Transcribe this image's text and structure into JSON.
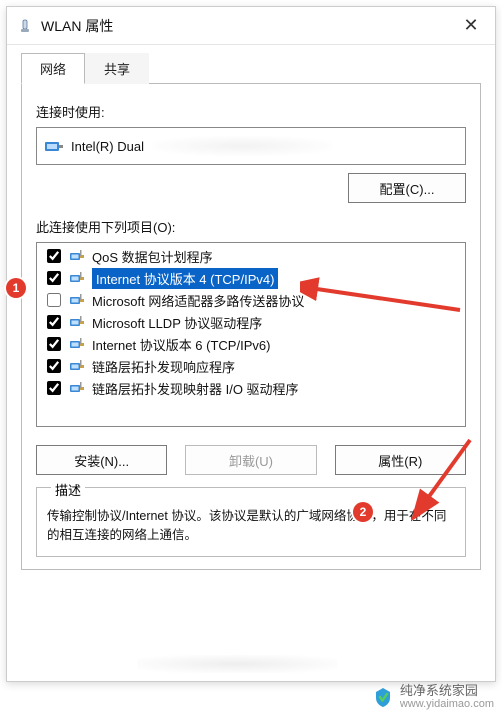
{
  "window": {
    "title": "WLAN 属性",
    "close_glyph": "✕"
  },
  "tabs": {
    "network": "网络",
    "sharing": "共享"
  },
  "labels": {
    "connect_using": "连接时使用:",
    "adapter": "Intel(R) Dual",
    "configure": "配置(C)...",
    "items_label": "此连接使用下列项目(O):",
    "install": "安装(N)...",
    "uninstall": "卸载(U)",
    "properties": "属性(R)",
    "desc_heading": "描述",
    "desc_body": "传输控制协议/Internet 协议。该协议是默认的广域网络协议，用于在不同的相互连接的网络上通信。"
  },
  "items": [
    {
      "checked": true,
      "icon": "net",
      "label": "QoS 数据包计划程序",
      "selected": false
    },
    {
      "checked": true,
      "icon": "net",
      "label": "Internet 协议版本 4 (TCP/IPv4)",
      "selected": true
    },
    {
      "checked": false,
      "icon": "net",
      "label": "Microsoft 网络适配器多路传送器协议",
      "selected": false
    },
    {
      "checked": true,
      "icon": "net",
      "label": "Microsoft LLDP 协议驱动程序",
      "selected": false
    },
    {
      "checked": true,
      "icon": "net",
      "label": "Internet 协议版本 6 (TCP/IPv6)",
      "selected": false
    },
    {
      "checked": true,
      "icon": "net",
      "label": "链路层拓扑发现响应程序",
      "selected": false
    },
    {
      "checked": true,
      "icon": "net",
      "label": "链路层拓扑发现映射器 I/O 驱动程序",
      "selected": false
    }
  ],
  "annotations": {
    "badge1": "1",
    "badge2": "2"
  },
  "watermark": {
    "brand": "纯净系统家园",
    "url": "www.yidaimao.com"
  }
}
